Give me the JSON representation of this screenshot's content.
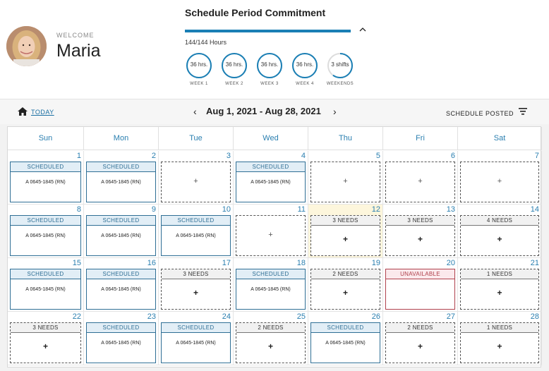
{
  "welcome": {
    "label": "WELCOME",
    "name": "Maria"
  },
  "commitment": {
    "title": "Schedule Period Commitment",
    "progress": 1.0,
    "hours_text": "144/144 Hours",
    "collapse_icon": "chevron-up-icon",
    "weeks": [
      {
        "label": "36 hrs.",
        "caption": "WEEK 1",
        "fraction": 1.0
      },
      {
        "label": "36 hrs.",
        "caption": "WEEK 2",
        "fraction": 1.0
      },
      {
        "label": "36 hrs.",
        "caption": "WEEK 3",
        "fraction": 1.0
      },
      {
        "label": "36 hrs.",
        "caption": "WEEK 4",
        "fraction": 1.0
      },
      {
        "label": "3 shifts",
        "caption": "WEEKENDS",
        "fraction": 0.6
      }
    ]
  },
  "nav": {
    "home_icon": "home-icon",
    "today": "TODAY",
    "prev": "‹",
    "range": "Aug 1, 2021 - Aug 28, 2021",
    "next": "›",
    "posted": "SCHEDULE POSTED",
    "filter_icon": "filter-icon"
  },
  "colors": {
    "accent": "#1a7fb5",
    "scheduled": "#2f6f95",
    "unavailable": "#b0414d",
    "highlight": "#fdf6dc"
  },
  "calendar": {
    "days": [
      "Sun",
      "Mon",
      "Tue",
      "Wed",
      "Thu",
      "Fri",
      "Sat"
    ],
    "weeks": [
      [
        {
          "day": "1",
          "type": "scheduled",
          "head": "SCHEDULED",
          "shift": "A 0645-1845 (RN)"
        },
        {
          "day": "2",
          "type": "scheduled",
          "head": "SCHEDULED",
          "shift": "A 0645-1845 (RN)"
        },
        {
          "day": "3",
          "type": "empty",
          "plus": "+"
        },
        {
          "day": "4",
          "type": "scheduled",
          "head": "SCHEDULED",
          "shift": "A 0645-1845 (RN)"
        },
        {
          "day": "5",
          "type": "empty",
          "plus": "+"
        },
        {
          "day": "6",
          "type": "empty",
          "plus": "+"
        },
        {
          "day": "7",
          "type": "empty",
          "plus": "+"
        }
      ],
      [
        {
          "day": "8",
          "type": "scheduled",
          "head": "SCHEDULED",
          "shift": "A 0645-1845 (RN)"
        },
        {
          "day": "9",
          "type": "scheduled",
          "head": "SCHEDULED",
          "shift": "A 0645-1845 (RN)"
        },
        {
          "day": "10",
          "type": "scheduled",
          "head": "SCHEDULED",
          "shift": "A 0645-1845 (RN)"
        },
        {
          "day": "11",
          "type": "empty",
          "plus": "+"
        },
        {
          "day": "12",
          "type": "needs",
          "head": "3 NEEDS",
          "plus": "+",
          "highlight": true
        },
        {
          "day": "13",
          "type": "needs",
          "head": "3 NEEDS",
          "plus": "+"
        },
        {
          "day": "14",
          "type": "needs",
          "head": "4 NEEDS",
          "plus": "+"
        }
      ],
      [
        {
          "day": "15",
          "type": "scheduled",
          "head": "SCHEDULED",
          "shift": "A 0645-1845 (RN)"
        },
        {
          "day": "16",
          "type": "scheduled",
          "head": "SCHEDULED",
          "shift": "A 0645-1845 (RN)"
        },
        {
          "day": "17",
          "type": "needs",
          "head": "3 NEEDS",
          "plus": "+"
        },
        {
          "day": "18",
          "type": "scheduled",
          "head": "SCHEDULED",
          "shift": "A 0645-1845 (RN)"
        },
        {
          "day": "19",
          "type": "needs",
          "head": "2 NEEDS",
          "plus": "+"
        },
        {
          "day": "20",
          "type": "unavail",
          "head": "UNAVAILABLE"
        },
        {
          "day": "21",
          "type": "needs",
          "head": "1 NEEDS",
          "plus": "+"
        }
      ],
      [
        {
          "day": "22",
          "type": "needs",
          "head": "3 NEEDS",
          "plus": "+"
        },
        {
          "day": "23",
          "type": "scheduled",
          "head": "SCHEDULED",
          "shift": "A 0645-1845 (RN)"
        },
        {
          "day": "24",
          "type": "scheduled",
          "head": "SCHEDULED",
          "shift": "A 0645-1845 (RN)"
        },
        {
          "day": "25",
          "type": "needs",
          "head": "2 NEEDS",
          "plus": "+"
        },
        {
          "day": "26",
          "type": "scheduled",
          "head": "SCHEDULED",
          "shift": "A 0645-1845 (RN)"
        },
        {
          "day": "27",
          "type": "needs",
          "head": "2 NEEDS",
          "plus": "+"
        },
        {
          "day": "28",
          "type": "needs",
          "head": "1 NEEDS",
          "plus": "+"
        }
      ]
    ]
  }
}
